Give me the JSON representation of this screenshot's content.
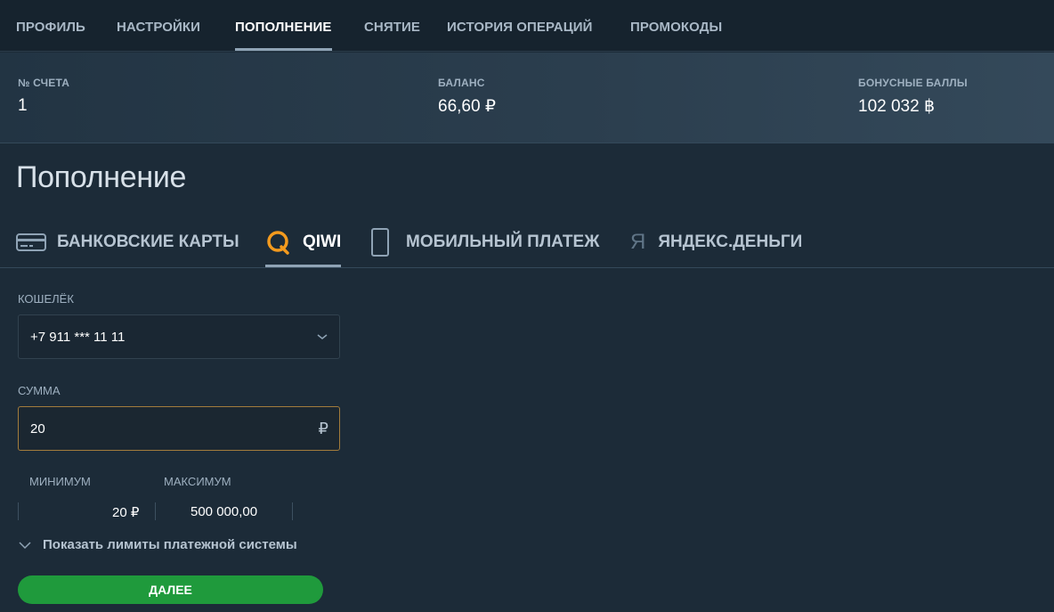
{
  "nav": {
    "tabs": [
      {
        "label": "ПРОФИЛЬ"
      },
      {
        "label": "НАСТРОЙКИ"
      },
      {
        "label": "ПОПОЛНЕНИЕ"
      },
      {
        "label": "СНЯТИЕ"
      },
      {
        "label": "ИСТОРИЯ ОПЕРАЦИЙ"
      },
      {
        "label": "ПРОМОКОДЫ"
      }
    ],
    "active_tab": "ПОПОЛНЕНИЕ"
  },
  "account": {
    "number_label": "№ СЧЕТА",
    "number_value": "1",
    "balance_label": "БАЛАНС",
    "balance_value": "66,60 ₽",
    "bonus_label": "БОНУСНЫЕ БАЛЛЫ",
    "bonus_value": "102 032 ฿"
  },
  "page_title": "Пополнение",
  "methods": {
    "items": [
      {
        "label": "БАНКОВСКИЕ КАРТЫ",
        "icon": "bank-card-icon"
      },
      {
        "label": "QIWI",
        "icon": "qiwi-icon"
      },
      {
        "label": "МОБИЛЬНЫЙ ПЛАТЕЖ",
        "icon": "mobile-phone-icon"
      },
      {
        "label": "ЯНДЕКС.ДЕНЬГИ",
        "icon": "yandex-icon"
      }
    ],
    "active": "QIWI",
    "yandex_glyph": "Я"
  },
  "form": {
    "wallet_label": "КОШЕЛЁК",
    "wallet_value": "+7 911 *** 11 11",
    "amount_label": "СУММА",
    "amount_value": "20",
    "currency_symbol": "₽"
  },
  "limits": {
    "min_label": "МИНИМУМ",
    "min_value": "20 ₽",
    "max_label": "МАКСИМУМ",
    "max_value": "500 000,00"
  },
  "show_limits_label": "Показать лимиты платежной системы",
  "next_button": "ДАЛЕЕ",
  "colors": {
    "accent_qiwi": "#f39a1e",
    "button_green": "#1f9a3c",
    "focus_border": "#a27c3c"
  }
}
